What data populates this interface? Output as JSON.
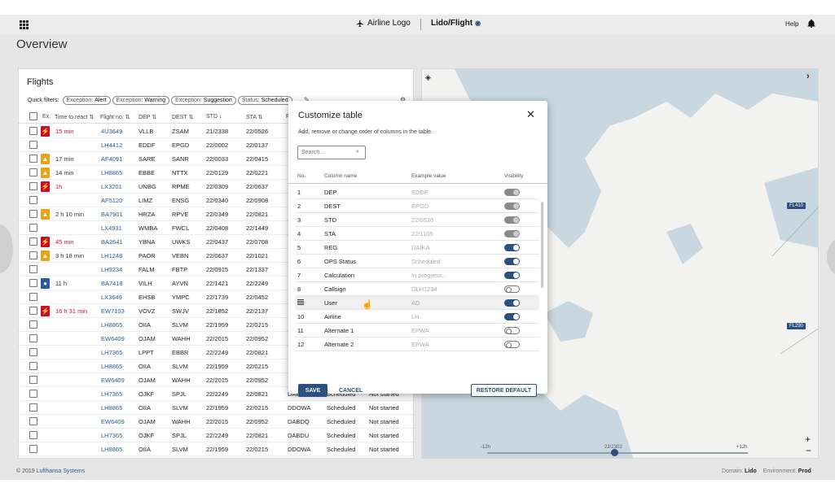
{
  "header": {
    "airline_logo": "Airline Logo",
    "product": "Lido/Flight",
    "help": "Help"
  },
  "page_title": "Overview",
  "flights": {
    "title": "Flights",
    "quick_filters_label": "Quick filters:",
    "filters": [
      {
        "key": "Exception:",
        "value": "Alert"
      },
      {
        "key": "Exception:",
        "value": "Warning"
      },
      {
        "key": "Exception:",
        "value": "Suggestion"
      },
      {
        "key": "Status:",
        "value": "Scheduled"
      }
    ],
    "columns": {
      "ex": "Ex.",
      "time_to_react": "Time to react ⇅",
      "flight_no": "Flight no. ⇅",
      "dep": "DEP ⇅",
      "dest": "DEST ⇅",
      "std": "STD ↓",
      "sta": "STA ⇅",
      "next": "F"
    },
    "rows": [
      {
        "exc": "alert",
        "react": "15 min",
        "fno": "4U3649",
        "dep": "VLLB",
        "dest": "ZSAM",
        "std": "21/2338",
        "sta": "22/0526",
        "reg": "",
        "status": "",
        "calc": ""
      },
      {
        "exc": "",
        "react": "",
        "fno": "LH4412",
        "dep": "EDDF",
        "dest": "EPGD",
        "std": "22/0002",
        "sta": "22/0137",
        "reg": "",
        "status": "",
        "calc": ""
      },
      {
        "exc": "warning",
        "react": "17 min",
        "fno": "AF4091",
        "dep": "SARE",
        "dest": "SANR",
        "std": "22/0033",
        "sta": "22/0415",
        "reg": "",
        "status": "",
        "calc": ""
      },
      {
        "exc": "warning",
        "react": "14 min",
        "fno": "LH8865",
        "dep": "EBBE",
        "dest": "NTTX",
        "std": "22/0129",
        "sta": "22/0221",
        "reg": "",
        "status": "",
        "calc": ""
      },
      {
        "exc": "alert",
        "react": "1h",
        "fno": "LX3201",
        "dep": "UNBG",
        "dest": "RPME",
        "std": "22/0309",
        "sta": "22/0637",
        "reg": "",
        "status": "",
        "calc": ""
      },
      {
        "exc": "",
        "react": "",
        "fno": "AF5120",
        "dep": "LIMZ",
        "dest": "ENSG",
        "std": "22/0340",
        "sta": "22/0908",
        "reg": "",
        "status": "",
        "calc": ""
      },
      {
        "exc": "warning",
        "react": "2 h 10 min",
        "fno": "BA7901",
        "dep": "HRZA",
        "dest": "RPVE",
        "std": "22/0349",
        "sta": "22/0821",
        "reg": "",
        "status": "",
        "calc": ""
      },
      {
        "exc": "",
        "react": "",
        "fno": "LX4931",
        "dep": "WMBA",
        "dest": "FWCL",
        "std": "22/0408",
        "sta": "22/1449",
        "reg": "",
        "status": "",
        "calc": ""
      },
      {
        "exc": "alert",
        "react": "45 min",
        "fno": "BA2641",
        "dep": "YBNA",
        "dest": "UWKS",
        "std": "22/0437",
        "sta": "22/0708",
        "reg": "",
        "status": "",
        "calc": ""
      },
      {
        "exc": "warning",
        "react": "3 h 18 min",
        "fno": "LH1248",
        "dep": "PAOR",
        "dest": "VEBN",
        "std": "22/0637",
        "sta": "22/1021",
        "reg": "",
        "status": "",
        "calc": ""
      },
      {
        "exc": "",
        "react": "",
        "fno": "LH9234",
        "dep": "FALM",
        "dest": "FBTP",
        "std": "22/0915",
        "sta": "22/1337",
        "reg": "",
        "status": "",
        "calc": ""
      },
      {
        "exc": "suggestion",
        "react": "11 h",
        "fno": "BA7418",
        "dep": "VILH",
        "dest": "AYVN",
        "std": "22/1421",
        "sta": "22/2249",
        "reg": "",
        "status": "",
        "calc": ""
      },
      {
        "exc": "",
        "react": "",
        "fno": "LX3649",
        "dep": "EHSB",
        "dest": "YMPC",
        "std": "22/1739",
        "sta": "22/0452",
        "reg": "",
        "status": "",
        "calc": ""
      },
      {
        "exc": "alert",
        "react": "16 h 31 min",
        "fno": "EW7103",
        "dep": "VOVZ",
        "dest": "SWJV",
        "std": "22/1852",
        "sta": "22/2137",
        "reg": "",
        "status": "",
        "calc": ""
      },
      {
        "exc": "",
        "react": "",
        "fno": "LH8865",
        "dep": "OIIA",
        "dest": "SLVM",
        "std": "22/1959",
        "sta": "22/0215",
        "reg": "",
        "status": "",
        "calc": ""
      },
      {
        "exc": "",
        "react": "",
        "fno": "EW6409",
        "dep": "OJAM",
        "dest": "WAHH",
        "std": "22/2015",
        "sta": "22/0952",
        "reg": "",
        "status": "",
        "calc": ""
      },
      {
        "exc": "",
        "react": "",
        "fno": "LH7365",
        "dep": "LPPT",
        "dest": "EBBR",
        "std": "22/2249",
        "sta": "22/0821",
        "reg": "",
        "status": "",
        "calc": ""
      },
      {
        "exc": "",
        "react": "",
        "fno": "LH8865",
        "dep": "OIIA",
        "dest": "SLVM",
        "std": "22/1959",
        "sta": "22/0215",
        "reg": "",
        "status": "",
        "calc": ""
      },
      {
        "exc": "",
        "react": "",
        "fno": "EW6409",
        "dep": "OJAM",
        "dest": "WAHH",
        "std": "22/2015",
        "sta": "22/0952",
        "reg": "",
        "status": "",
        "calc": ""
      },
      {
        "exc": "",
        "react": "",
        "fno": "LH7365",
        "dep": "OJKF",
        "dest": "SPJL",
        "std": "22/2249",
        "sta": "22/0821",
        "reg": "DABDU",
        "status": "Scheduled",
        "calc": "Not started"
      },
      {
        "exc": "",
        "react": "",
        "fno": "LH8865",
        "dep": "OIIA",
        "dest": "SLVM",
        "std": "22/1959",
        "sta": "22/0215",
        "reg": "DDOWA",
        "status": "Scheduled",
        "calc": "Not started"
      },
      {
        "exc": "",
        "react": "",
        "fno": "EW6409",
        "dep": "OJAM",
        "dest": "WAHH",
        "std": "22/2015",
        "sta": "22/0952",
        "reg": "DABDQ",
        "status": "Scheduled",
        "calc": "Not started"
      },
      {
        "exc": "",
        "react": "",
        "fno": "LH7365",
        "dep": "OJKF",
        "dest": "SPJL",
        "std": "22/2249",
        "sta": "22/0821",
        "reg": "DABDU",
        "status": "Scheduled",
        "calc": "Not started"
      },
      {
        "exc": "",
        "react": "",
        "fno": "LH8865",
        "dep": "OIIA",
        "dest": "SLVM",
        "std": "22/1959",
        "sta": "22/0215",
        "reg": "DDOWA",
        "status": "Scheduled",
        "calc": "Not started"
      }
    ]
  },
  "map": {
    "labels": [
      "FL410",
      "FL290"
    ],
    "timeline": {
      "start": "-12h",
      "current": "22/2302",
      "end": "+12h"
    },
    "zoom_in": "+",
    "zoom_out": "−"
  },
  "modal": {
    "title": "Customize table",
    "description": "Add, remove or change order of columns in the table.",
    "search_placeholder": "Search...",
    "columns": {
      "no": "No.",
      "name": "Column name",
      "example": "Example value",
      "visibility": "Visibility"
    },
    "rows": [
      {
        "no": "1",
        "name": "DEP",
        "example": "EDDF",
        "state": "locked"
      },
      {
        "no": "2",
        "name": "DEST",
        "example": "EPGD",
        "state": "locked"
      },
      {
        "no": "3",
        "name": "STD",
        "example": "22/0526",
        "state": "locked"
      },
      {
        "no": "4",
        "name": "STA",
        "example": "22/1105",
        "state": "locked"
      },
      {
        "no": "5",
        "name": "REG",
        "example": "DAIKA",
        "state": "on"
      },
      {
        "no": "6",
        "name": "OPS Status",
        "example": "Scheduled",
        "state": "on"
      },
      {
        "no": "7",
        "name": "Calculation",
        "example": "In progress...",
        "state": "on"
      },
      {
        "no": "8",
        "name": "Callsign",
        "example": "DLH1234",
        "state": "off"
      },
      {
        "no": "",
        "name": "User",
        "example": "AD",
        "state": "on",
        "dragging": true
      },
      {
        "no": "10",
        "name": "Airline",
        "example": "LH",
        "state": "on"
      },
      {
        "no": "11",
        "name": "Alternate 1",
        "example": "EPWA",
        "state": "off"
      },
      {
        "no": "12",
        "name": "Alternate 2",
        "example": "EPWA",
        "state": "off"
      }
    ],
    "save": "SAVE",
    "cancel": "CANCEL",
    "restore": "RESTORE DEFAULT"
  },
  "footer": {
    "copyright": "© 2019",
    "company": "Lufthansa Systems",
    "domain_label": "Domain:",
    "domain_value": "Lido",
    "env_label": "Environment:",
    "env_value": "Prod"
  },
  "colors": {
    "primary": "#2a5080",
    "alert": "#c8102e",
    "warning": "#e8a317",
    "suggestion": "#2a5a9a",
    "map_sea": "#c9d7e0",
    "map_land": "#f2f2f0"
  }
}
